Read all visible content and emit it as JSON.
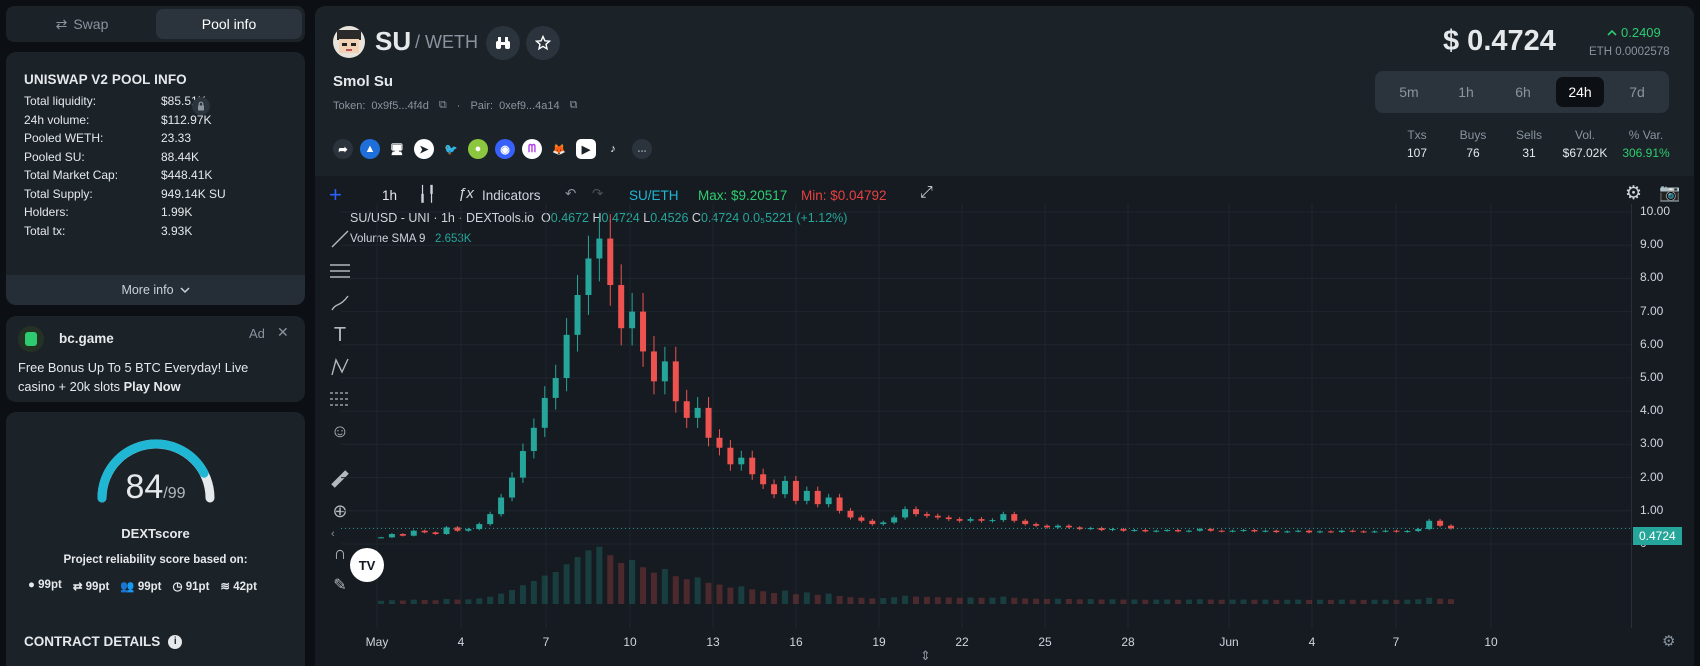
{
  "tabs": {
    "swap": "Swap",
    "pool_info": "Pool info"
  },
  "pool_info": {
    "title": "UNISWAP V2 POOL INFO",
    "rows": [
      {
        "k": "Total liquidity:",
        "v": "$85.51K"
      },
      {
        "k": "24h volume:",
        "v": "$112.97K"
      },
      {
        "k": "Pooled WETH:",
        "v": "23.33"
      },
      {
        "k": "Pooled SU:",
        "v": "88.44K"
      },
      {
        "k": "Total Market Cap:",
        "v": "$448.41K"
      },
      {
        "k": "Total Supply:",
        "v": "949.14K SU"
      },
      {
        "k": "Holders:",
        "v": "1.99K"
      },
      {
        "k": "Total tx:",
        "v": "3.93K"
      }
    ],
    "more": "More info"
  },
  "ad": {
    "name": "bc.game",
    "tag": "Ad",
    "text": "Free Bonus Up To 5 BTC Everyday! Live casino + 20k slots",
    "cta": "Play Now"
  },
  "score": {
    "value": "84",
    "max": "/99",
    "label": "DEXTscore",
    "desc": "Project reliability score based on:",
    "items": [
      "99pt",
      "99pt",
      "99pt",
      "91pt",
      "42pt"
    ],
    "level": 0.848
  },
  "contract": {
    "title": "CONTRACT DETAILS"
  },
  "token": {
    "symbol": "SU",
    "pair": "/ WETH",
    "name": "Smol Su",
    "token_label": "Token:",
    "token_addr": "0x9f5...4f4d",
    "pair_label": "Pair:",
    "pair_addr": "0xef9...4a14",
    "price": "$ 0.4724",
    "change": "0.2409",
    "eth_price": "ETH 0.0002578",
    "more_socials": "..."
  },
  "timeframes": [
    "5m",
    "1h",
    "6h",
    "24h",
    "7d"
  ],
  "active_tf": "24h",
  "stats": {
    "labels": [
      "Txs",
      "Buys",
      "Sells",
      "Vol.",
      "% Var."
    ],
    "values": [
      "107",
      "76",
      "31",
      "$67.02K",
      "306.91%"
    ]
  },
  "chart_toolbar": {
    "interval": "1h",
    "indicators": "Indicators",
    "pair": "SU/ETH",
    "max": "Max: $9.20517",
    "min": "Min: $0.04792"
  },
  "chart_legend": {
    "title": "SU/USD - UNI · 1h · DEXTools.io",
    "o_label": "O",
    "o": "0.4672",
    "h_label": "H",
    "h": "0.4724",
    "l_label": "L",
    "l": "0.4526",
    "c_label": "C",
    "c": "0.4724",
    "change": "0.0₅5221 (+1.12%)",
    "vol_label": "Volume SMA 9",
    "vol_value": "2.653K"
  },
  "colors": {
    "up": "#26a69a",
    "down": "#ef5350",
    "accent": "#1fb7d4",
    "green": "#2ecc71",
    "red": "#e84040"
  },
  "chart_data": {
    "type": "line",
    "title": "SU/USD - UNI · 1h · DEXTools.io",
    "x_tick_labels": [
      "May",
      "4",
      "7",
      "10",
      "13",
      "16",
      "19",
      "22",
      "25",
      "28",
      "Jun",
      "4",
      "7",
      "10"
    ],
    "y_tick_labels": [
      "10.00",
      "9.00",
      "8.00",
      "7.00",
      "6.00",
      "5.00",
      "4.00",
      "3.00",
      "2.00",
      "1.00",
      "0"
    ],
    "ylim": [
      0,
      10
    ],
    "last_price_label": "0.4724",
    "series": [
      {
        "values": [
          0.2,
          0.3,
          0.25,
          0.4,
          0.35,
          0.3,
          0.5,
          0.4,
          0.45,
          0.6,
          0.9,
          1.4,
          2.0,
          2.8,
          3.5,
          4.4,
          5.0,
          6.3,
          7.5,
          8.6,
          9.2,
          7.8,
          6.5,
          7.0,
          5.8,
          4.9,
          5.5,
          4.3,
          3.8,
          4.1,
          3.2,
          2.9,
          2.4,
          2.6,
          2.1,
          1.8,
          1.5,
          1.9,
          1.3,
          1.6,
          1.2,
          1.4,
          1.0,
          0.8,
          0.7,
          0.6,
          0.65,
          0.8,
          1.05,
          0.9,
          0.85,
          0.8,
          0.75,
          0.7,
          0.75,
          0.7,
          0.72,
          0.9,
          0.7,
          0.6,
          0.55,
          0.5,
          0.55,
          0.5,
          0.45,
          0.48,
          0.42,
          0.45,
          0.4,
          0.42,
          0.38,
          0.4,
          0.42,
          0.38,
          0.4,
          0.45,
          0.4,
          0.38,
          0.4,
          0.42,
          0.38,
          0.4,
          0.36,
          0.38,
          0.4,
          0.35,
          0.38,
          0.36,
          0.4,
          0.38,
          0.36,
          0.38,
          0.4,
          0.37,
          0.39,
          0.45,
          0.7,
          0.55,
          0.47
        ]
      }
    ]
  }
}
